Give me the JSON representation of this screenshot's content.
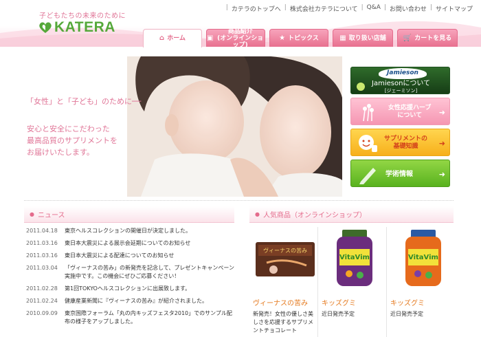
{
  "header": {
    "tagline": "子どもたちの未来のために",
    "logo": "KATERA",
    "topnav": [
      "カテラのトップへ",
      "株式会社カテラについて",
      "Q&A",
      "お問い合わせ",
      "サイトマップ"
    ],
    "tabs": [
      {
        "label": "ホーム",
        "icon": "home-icon"
      },
      {
        "label": "商品紹介",
        "sub": "(オンラインショップ)",
        "icon": "gift-icon"
      },
      {
        "label": "トピックス",
        "icon": "star-icon"
      },
      {
        "label": "取り扱い店舗",
        "icon": "shop-icon"
      },
      {
        "label": "カートを見る",
        "icon": "cart-icon"
      }
    ]
  },
  "hero": {
    "title": "「女性」と「子ども」のために──",
    "lines": [
      "安心と安全にこだわった",
      "最高品質のサプリメントを",
      "お届けいたします。"
    ]
  },
  "banners": {
    "jamieson": {
      "logo": "Jamieson",
      "text": "Jamiesonについて",
      "sub": "[ジェーミソン]"
    },
    "herb": {
      "line1": "女性応援ハーブ",
      "line2": "について"
    },
    "supplement": {
      "line1": "サプリメントの",
      "line2": "基礎知識"
    },
    "academic": {
      "text": "学術情報"
    }
  },
  "news": {
    "heading": "ニュース",
    "items": [
      {
        "date": "2011.04.18",
        "text": "東京ヘルスコレクションの開催日が決定しました。"
      },
      {
        "date": "2011.03.16",
        "text": "東日本大震災による展示会延期についてのお知らせ"
      },
      {
        "date": "2011.03.16",
        "text": "東日本大震災による配達についてのお知らせ"
      },
      {
        "date": "2011.03.04",
        "text": "「ヴィーナスの苦み」の新発売を記念して、プレゼントキャンペーン実施中です。この機会にぜひご応募ください！"
      },
      {
        "date": "2011.02.28",
        "text": "第1回TOKYOヘルスコレクションに出展致します。"
      },
      {
        "date": "2011.02.24",
        "text": "健康産業新聞に『ヴィーナスの苦み』が紹介されました。"
      },
      {
        "date": "2010.09.09",
        "text": "東京国際フォーラム「丸の内キッズフェスタ2010」でのサンプル配布の様子をアップしました。"
      }
    ]
  },
  "products": {
    "heading": "人気商品（オンラインショップ）",
    "items": [
      {
        "name": "ヴィーナスの苦み",
        "desc": "新発売！女性の優しさ美しさを応援するサプリメントチョコレート",
        "label": "ヴィーナスの苦み"
      },
      {
        "name": "キッズグミ",
        "desc": "近日発売予定",
        "label": "VitaVim"
      },
      {
        "name": "キッズグミ",
        "desc": "近日発売予定",
        "label": "VitaVim"
      }
    ]
  }
}
